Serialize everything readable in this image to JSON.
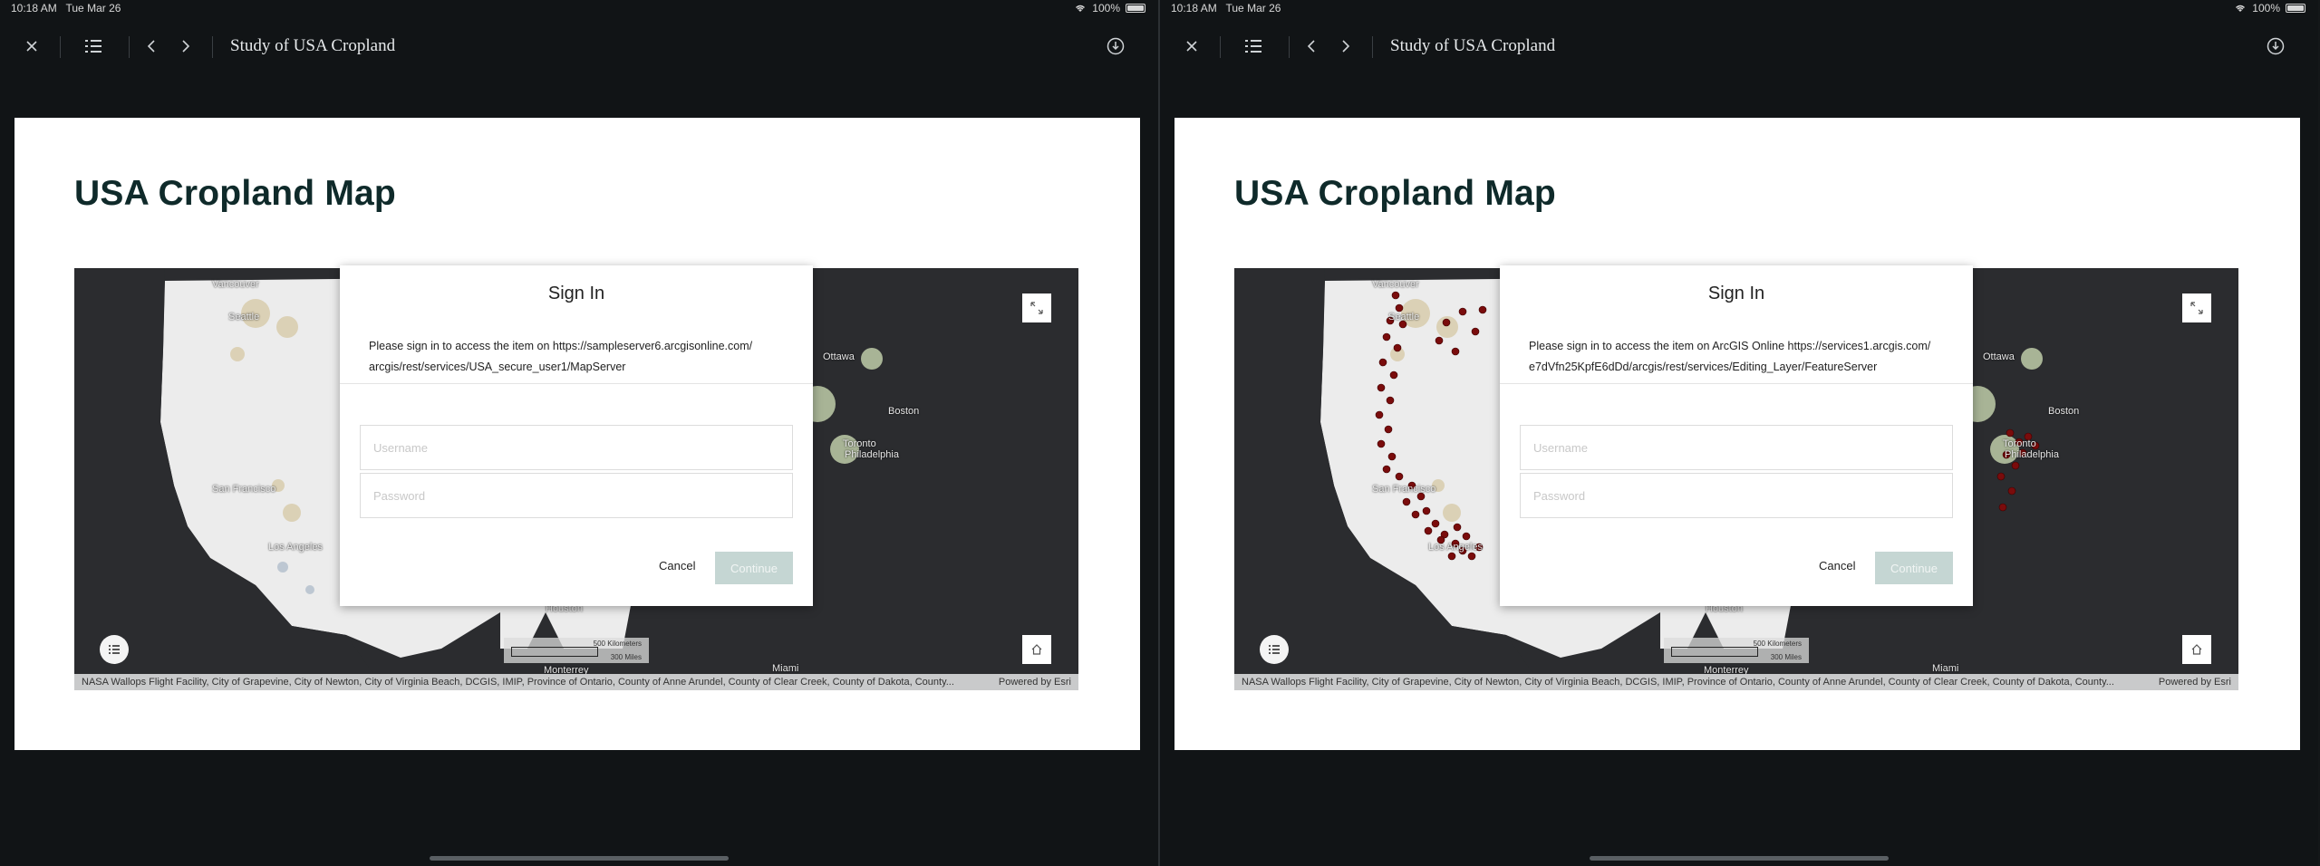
{
  "panels": [
    {
      "status": {
        "time": "10:18 AM",
        "date": "Tue Mar 26",
        "battery": "100%"
      },
      "toolbar": {
        "title": "Study of USA Cropland"
      },
      "slide": {
        "title": "USA Cropland Map"
      },
      "map": {
        "labels": {
          "vancouver": "Vancouver",
          "seattle": "Seattle",
          "sanfrancisco": "San Francisco",
          "losangeles": "Los Angeles",
          "ottawa": "Ottawa",
          "boston": "Boston",
          "philadelphia": "Philadelphia",
          "toronto": "Toronto",
          "monterrey": "Monterrey",
          "houston": "Houston",
          "miami": "Miami"
        },
        "scale": {
          "km": "500 Kilometers",
          "mi": "300 Miles"
        },
        "attribution": "NASA Wallops Flight Facility, City of Grapevine, City of Newton, City of Virginia Beach, DCGIS, IMIP, Province of Ontario, County of Anne Arundel, County of Clear Creek, County of Dakota, County...",
        "powered": "Powered by Esri",
        "points_shown": false
      },
      "dialog": {
        "title": "Sign In",
        "message_line1": "Please sign in to access the item on https://sampleserver6.arcgisonline.com/",
        "message_line2": "arcgis/rest/services/USA_secure_user1/MapServer",
        "username_placeholder": "Username",
        "password_placeholder": "Password",
        "cancel": "Cancel",
        "continue": "Continue"
      }
    },
    {
      "status": {
        "time": "10:18 AM",
        "date": "Tue Mar 26",
        "battery": "100%"
      },
      "toolbar": {
        "title": "Study of USA Cropland"
      },
      "slide": {
        "title": "USA Cropland Map"
      },
      "map": {
        "labels": {
          "vancouver": "Vancouver",
          "seattle": "Seattle",
          "sanfrancisco": "San Francisco",
          "losangeles": "Los Angeles",
          "ottawa": "Ottawa",
          "boston": "Boston",
          "philadelphia": "Philadelphia",
          "toronto": "Toronto",
          "monterrey": "Monterrey",
          "houston": "Houston",
          "miami": "Miami"
        },
        "scale": {
          "km": "500 Kilometers",
          "mi": "300 Miles"
        },
        "attribution": "NASA Wallops Flight Facility, City of Grapevine, City of Newton, City of Virginia Beach, DCGIS, IMIP, Province of Ontario, County of Anne Arundel, County of Clear Creek, County of Dakota, County...",
        "powered": "Powered by Esri",
        "points_shown": true
      },
      "dialog": {
        "title": "Sign In",
        "message_line1": "Please sign in to access the item on ArcGIS Online https://services1.arcgis.com/",
        "message_line2": "e7dVfn25KpfE6dDd/arcgis/rest/services/Editing_Layer/FeatureServer",
        "username_placeholder": "Username",
        "password_placeholder": "Password",
        "cancel": "Cancel",
        "continue": "Continue"
      }
    }
  ],
  "colors": {
    "background": "#141719",
    "slide_title": "#0f2a2a",
    "continue_disabled": "#c5d6d3",
    "map_base": "#2b2c2f",
    "land": "#ececec",
    "feature_points": "#7a0c0c"
  },
  "icons": [
    "close-icon",
    "list-icon",
    "chevron-left-icon",
    "chevron-right-icon",
    "info-icon",
    "expand-icon",
    "legend-icon",
    "home-icon",
    "wifi-icon",
    "battery-icon"
  ]
}
